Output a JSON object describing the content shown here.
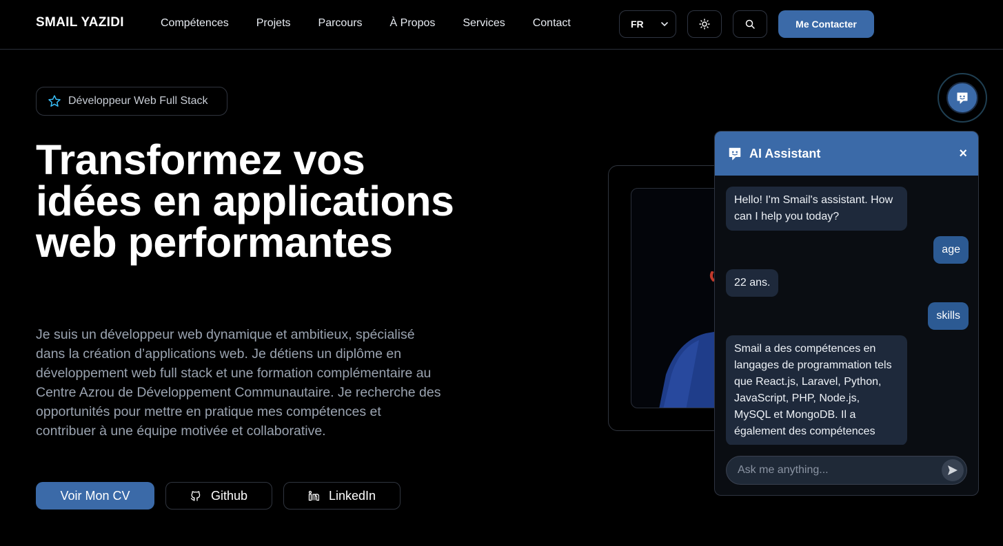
{
  "header": {
    "brand": "SMAIL YAZIDI",
    "nav": [
      "Compétences",
      "Projets",
      "Parcours",
      "À Propos",
      "Services",
      "Contact"
    ],
    "language": "FR",
    "contact_button": "Me Contacter"
  },
  "hero": {
    "badge": "Développeur Web Full Stack",
    "title": "Transformez vos idées en applications web performantes",
    "description": "Je suis un développeur web dynamique et ambitieux, spécialisé dans la création d’applications web. Je détiens un diplôme en développement web full stack et une formation complémentaire au Centre Azrou de Développement Communautaire. Je recherche des opportunités pour mettre en pratique mes compétences et contribuer à une équipe motivée et collaborative.",
    "buttons": {
      "cv": "Voir Mon CV",
      "github": "Github",
      "linkedin": "LinkedIn"
    }
  },
  "chat": {
    "title": "AI Assistant",
    "close": "×",
    "messages": [
      {
        "role": "bot",
        "text": "Hello! I'm Smail's assistant. How can I help you today?"
      },
      {
        "role": "user",
        "text": "age"
      },
      {
        "role": "bot",
        "text": "22 ans."
      },
      {
        "role": "user",
        "text": "skills"
      },
      {
        "role": "bot",
        "text": "Smail a des compétences en langages de programmation tels que React.js, Laravel, Python, JavaScript, PHP, Node.js, MySQL et MongoDB. Il a également des compétences"
      }
    ],
    "input_placeholder": "Ask me anything..."
  },
  "colors": {
    "accent": "#3b6aa8",
    "background": "#000000",
    "bubble_bot": "#1e293b",
    "bubble_user": "#2c5a93"
  },
  "icons": [
    "chevron-down-icon",
    "sun-icon",
    "search-icon",
    "star-icon",
    "github-icon",
    "linkedin-icon",
    "chat-bot-icon",
    "send-icon",
    "close-icon"
  ]
}
